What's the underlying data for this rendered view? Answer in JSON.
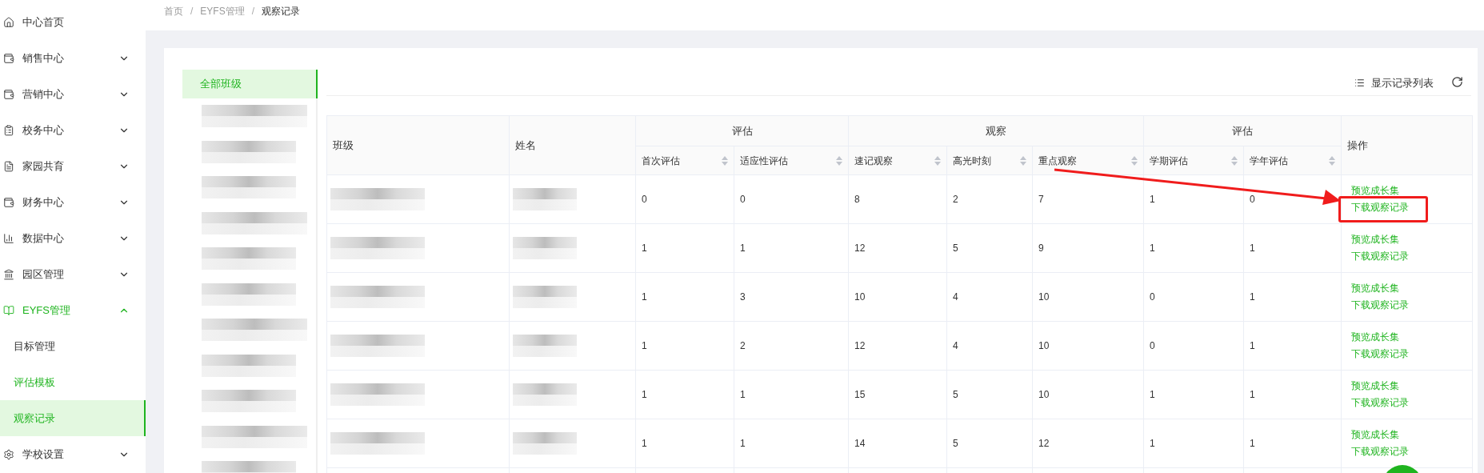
{
  "breadcrumb_separator": "/",
  "breadcrumb": [
    {
      "label": "首页",
      "current": false
    },
    {
      "label": "EYFS管理",
      "current": false
    },
    {
      "label": "观察记录",
      "current": true
    }
  ],
  "sidebar": {
    "items": [
      {
        "label": "中心首页",
        "expandable": false,
        "expanded": false
      },
      {
        "label": "销售中心",
        "expandable": true,
        "expanded": false
      },
      {
        "label": "营销中心",
        "expandable": true,
        "expanded": false
      },
      {
        "label": "校务中心",
        "expandable": true,
        "expanded": false
      },
      {
        "label": "家园共育",
        "expandable": true,
        "expanded": false
      },
      {
        "label": "财务中心",
        "expandable": true,
        "expanded": false
      },
      {
        "label": "数据中心",
        "expandable": true,
        "expanded": false
      },
      {
        "label": "园区管理",
        "expandable": true,
        "expanded": false
      },
      {
        "label": "EYFS管理",
        "expandable": true,
        "expanded": true,
        "children": [
          {
            "label": "目标管理",
            "selected": false,
            "highlighted": false
          },
          {
            "label": "评估模板",
            "selected": false,
            "highlighted": true
          },
          {
            "label": "观察记录",
            "selected": true,
            "highlighted": true
          }
        ]
      },
      {
        "label": "学校设置",
        "expandable": true,
        "expanded": false
      }
    ]
  },
  "class_list": {
    "items": [
      {
        "label": "全部班级",
        "selected": true
      }
    ]
  },
  "toolbar": {
    "toggle": "显示记录列表"
  },
  "table": {
    "columns": [
      "班级",
      "姓名"
    ],
    "groups": [
      {
        "label": "评估",
        "columns": [
          "首次评估",
          "适应性评估"
        ]
      },
      {
        "label": "观察",
        "columns": [
          "速记观察",
          "高光时刻",
          "重点观察"
        ]
      },
      {
        "label": "评估",
        "columns": [
          "学期评估",
          "学年评估"
        ]
      }
    ],
    "action_column": "操作",
    "rows": [
      {
        "values": [
          "0",
          "0",
          "8",
          "2",
          "7",
          "1",
          "0"
        ],
        "actions": [
          "预览成长集",
          "下载观察记录"
        ],
        "highlighted": true
      },
      {
        "values": [
          "1",
          "1",
          "12",
          "5",
          "9",
          "1",
          "1"
        ],
        "actions": [
          "预览成长集",
          "下载观察记录"
        ],
        "highlighted": false
      },
      {
        "values": [
          "1",
          "3",
          "10",
          "4",
          "10",
          "0",
          "1"
        ],
        "actions": [
          "预览成长集",
          "下载观察记录"
        ],
        "highlighted": false
      },
      {
        "values": [
          "1",
          "2",
          "12",
          "4",
          "10",
          "0",
          "1"
        ],
        "actions": [
          "预览成长集",
          "下载观察记录"
        ],
        "highlighted": false
      },
      {
        "values": [
          "1",
          "1",
          "15",
          "5",
          "10",
          "1",
          "1"
        ],
        "actions": [
          "预览成长集",
          "下载观察记录"
        ],
        "highlighted": false
      },
      {
        "values": [
          "1",
          "1",
          "14",
          "5",
          "12",
          "1",
          "1"
        ],
        "actions": [
          "预览成长集",
          "下载观察记录"
        ],
        "highlighted": false
      }
    ]
  }
}
